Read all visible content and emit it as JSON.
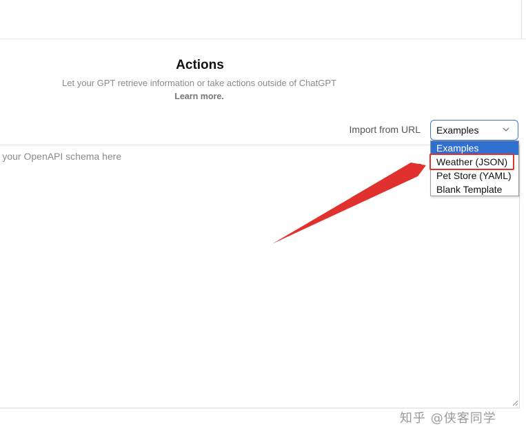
{
  "actions": {
    "title": "Actions",
    "subtitle": "Let your GPT retrieve information or take actions outside of ChatGPT",
    "learn_more": "Learn more."
  },
  "import": {
    "label": "Import from URL"
  },
  "examples_select": {
    "value": "Examples",
    "options": [
      "Examples",
      "Weather (JSON)",
      "Pet Store (YAML)",
      "Blank Template"
    ],
    "selected_index": 0,
    "highlighted_option": "Weather (JSON)"
  },
  "schema": {
    "placeholder": "Enter your OpenAPI schema here"
  },
  "annotation": {
    "color": "#e0312f"
  },
  "watermark": {
    "text": "知乎 @侠客同学"
  },
  "colors": {
    "select_border": "#3b74c9",
    "option_selected_bg": "#2f6fd0"
  }
}
